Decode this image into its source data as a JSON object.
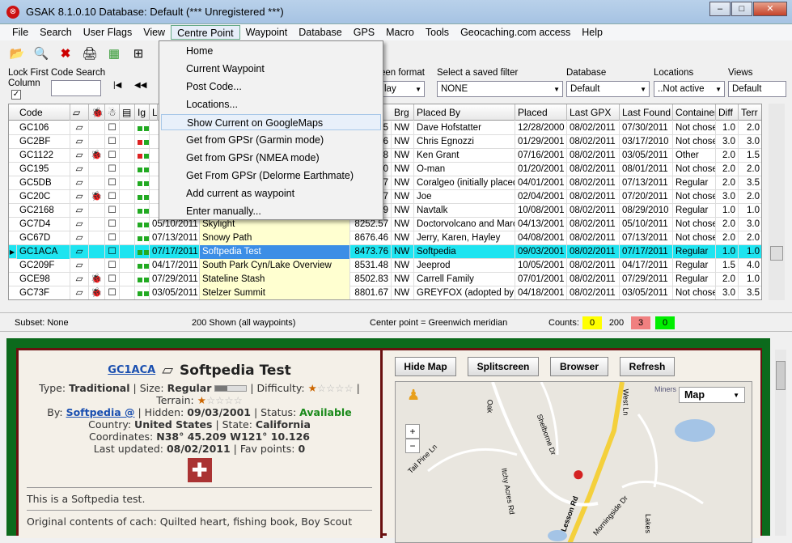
{
  "window": {
    "title": "GSAK 8.1.0.10    Database: Default    (*** Unregistered ***)",
    "app_icon": "gsak-logo-icon",
    "watermark": "SOFTPEDIA"
  },
  "menu": [
    "File",
    "Search",
    "User Flags",
    "View",
    "Centre Point",
    "Waypoint",
    "Database",
    "GPS",
    "Macro",
    "Tools",
    "Geocaching.com access",
    "Help"
  ],
  "dropdown": [
    "Home",
    "Current Waypoint",
    "Post Code...",
    "Locations...",
    "Show Current on GoogleMaps",
    "Get from GPSr (Garmin mode)",
    "Get from GPSr (NMEA mode)",
    "Get From GPSr (Delorme Earthmate)",
    "Add current as waypoint",
    "Enter manually..."
  ],
  "filters": {
    "lock_first_column": "Lock First Column",
    "code_search": "Code Search",
    "screen_format_label": "een format",
    "screen_format_value": "lay",
    "saved_filter_label": "Select a saved filter",
    "saved_filter_value": "NONE",
    "database_label": "Database",
    "database_value": "Default",
    "locations_label": "Locations",
    "locations_value": "..Not active",
    "views_label": "Views",
    "views_value": "Default"
  },
  "columns": [
    "Code",
    "",
    "",
    "",
    "",
    "Ig",
    "L",
    "Brg",
    "Placed By",
    "Placed",
    "Last GPX",
    "Last Found",
    "Container",
    "Diff",
    "Terr"
  ],
  "rows": [
    {
      "code": "GC106",
      "date": "",
      "name": "",
      "dist": "5",
      "brg": "NW",
      "by": "Dave Hofstatter",
      "placed": "12/28/2000",
      "gpx": "08/02/2011",
      "found": "07/30/2011",
      "cont": "Not chose",
      "diff": "1.0",
      "terr": "2.0"
    },
    {
      "code": "GC2BF",
      "date": "",
      "name": "",
      "dist": "6",
      "brg": "NW",
      "by": "Chris Egnozzi",
      "placed": "01/29/2001",
      "gpx": "08/02/2011",
      "found": "03/17/2010",
      "cont": "Not chose",
      "diff": "3.0",
      "terr": "3.0"
    },
    {
      "code": "GC1122",
      "date": "",
      "name": "",
      "dist": "8",
      "brg": "NW",
      "by": " Ken Grant",
      "placed": "07/16/2001",
      "gpx": "08/02/2011",
      "found": "03/05/2011",
      "cont": "Other",
      "diff": "2.0",
      "terr": "1.5"
    },
    {
      "code": "GC195",
      "date": "",
      "name": "",
      "dist": "0",
      "brg": "NW",
      "by": "O-man",
      "placed": "01/20/2001",
      "gpx": "08/02/2011",
      "found": "08/01/2011",
      "cont": "Not chose",
      "diff": "2.0",
      "terr": "2.0"
    },
    {
      "code": "GC5DB",
      "date": "",
      "name": "",
      "dist": "7",
      "brg": "NW",
      "by": "Coralgeo (initially placed b",
      "placed": "04/01/2001",
      "gpx": "08/02/2011",
      "found": "07/13/2011",
      "cont": "Regular",
      "diff": "2.0",
      "terr": "3.5"
    },
    {
      "code": "GC20C",
      "date": "",
      "name": "",
      "dist": "7",
      "brg": "NW",
      "by": "Joe",
      "placed": "02/04/2001",
      "gpx": "08/02/2011",
      "found": "07/20/2011",
      "cont": "Not chose",
      "diff": "3.0",
      "terr": "2.0"
    },
    {
      "code": "GC2168",
      "date": "",
      "name": "",
      "dist": "9",
      "brg": "NW",
      "by": "Navtalk",
      "placed": "10/08/2001",
      "gpx": "08/02/2011",
      "found": "08/29/2010",
      "cont": "Regular",
      "diff": "1.0",
      "terr": "1.0"
    },
    {
      "code": "GC7D4",
      "date": "05/10/2011",
      "name": "Skylight",
      "dist": "8252.57",
      "brg": "NW",
      "by": "Doctorvolcano and Marcy",
      "placed": "04/13/2001",
      "gpx": "08/02/2011",
      "found": "05/10/2011",
      "cont": "Not chose",
      "diff": "2.0",
      "terr": "3.0"
    },
    {
      "code": "GC67D",
      "date": "07/13/2011",
      "name": "Snowy Path",
      "dist": "8676.46",
      "brg": "NW",
      "by": "Jerry, Karen, Hayley",
      "placed": "04/08/2001",
      "gpx": "08/02/2011",
      "found": "07/13/2011",
      "cont": "Not chose",
      "diff": "2.0",
      "terr": "2.0"
    },
    {
      "code": "GC1ACA",
      "date": "07/17/2011",
      "name": "Softpedia Test",
      "dist": "8473.76",
      "brg": "NW",
      "by": "Softpedia",
      "placed": "09/03/2001",
      "gpx": "08/02/2011",
      "found": "07/17/2011",
      "cont": "Regular",
      "diff": "1.0",
      "terr": "1.0"
    },
    {
      "code": "GC209F",
      "date": "04/17/2011",
      "name": "South Park Cyn/Lake Overview",
      "dist": "8531.48",
      "brg": "NW",
      "by": "Jeeprod",
      "placed": "10/05/2001",
      "gpx": "08/02/2011",
      "found": "04/17/2011",
      "cont": "Regular",
      "diff": "1.5",
      "terr": "4.0"
    },
    {
      "code": "GCE98",
      "date": "07/29/2011",
      "name": "Stateline Stash",
      "dist": "8502.83",
      "brg": "NW",
      "by": "Carrell Family",
      "placed": "07/01/2001",
      "gpx": "08/02/2011",
      "found": "07/29/2011",
      "cont": "Regular",
      "diff": "2.0",
      "terr": "1.0"
    },
    {
      "code": "GC73F",
      "date": "03/05/2011",
      "name": "Stelzer Summit",
      "dist": "8801.67",
      "brg": "NW",
      "by": "GREYFOX (adopted by N",
      "placed": "04/18/2001",
      "gpx": "08/02/2011",
      "found": "03/05/2011",
      "cont": "Not chose",
      "diff": "3.0",
      "terr": "3.5"
    }
  ],
  "status": {
    "subset": "Subset: None",
    "shown": "200 Shown (all waypoints)",
    "center": "Center point = Greenwich meridian",
    "counts_label": "Counts:",
    "c1": "0",
    "c2": "200",
    "c3": "3",
    "c4": "0"
  },
  "cache": {
    "code": "GC1ACA",
    "name": "Softpedia Test",
    "type_label": "Type:",
    "type": "Traditional",
    "size_label": "| Size:",
    "size": "Regular",
    "difficulty_label": "| Difficulty:",
    "terrain_label": "Terrain:",
    "by_label": "By:",
    "by": "Softpedia @",
    "hidden_label": "| Hidden:",
    "hidden": "09/03/2001",
    "status_label": "| Status:",
    "status": "Available",
    "country_label": "Country:",
    "country": "United States",
    "state_label": "| State:",
    "state": "California",
    "coords_label": "Coordinates:",
    "coords": "N38° 45.209 W121° 10.126",
    "updated_label": "Last updated:",
    "updated": "08/02/2011",
    "fav_label": "| Fav points:",
    "fav": "0",
    "desc": "This is a Softpedia test.",
    "orig": "Original contents of cach: Quilted heart, fishing book, Boy Scout"
  },
  "map_buttons": [
    "Hide Map",
    "Splitscreen",
    "Browser",
    "Refresh"
  ],
  "map": {
    "type": "Map",
    "streets": [
      "Oak",
      "Tail Pine Ln",
      "Itchy Acres Rd",
      "Shelborne Dr",
      "Morningside Dr",
      "Lakes",
      "West Ln",
      "Miners"
    ],
    "road": "Lesson Rd"
  }
}
